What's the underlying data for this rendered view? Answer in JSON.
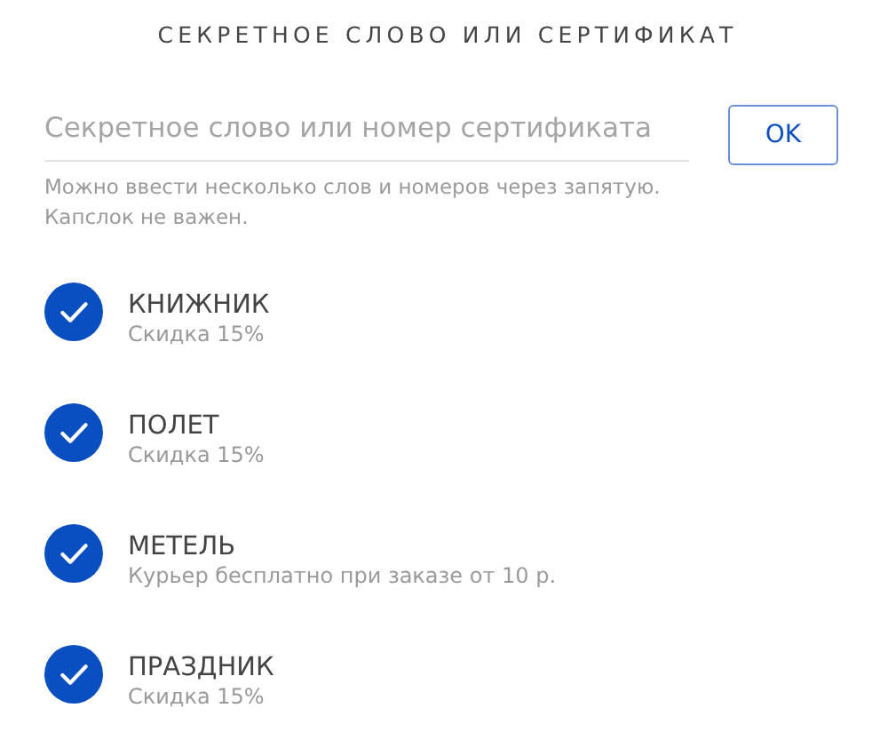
{
  "title": "СЕКРЕТНОЕ СЛОВО ИЛИ СЕРТИФИКАТ",
  "code_field": {
    "placeholder": "Секретное слово или номер сертификата"
  },
  "submit_button": "OK",
  "hint": [
    "Можно ввести несколько слов и номеров через запятую.",
    "Капслок не важен."
  ],
  "codes": [
    {
      "name": "КНИЖНИК",
      "description": "Скидка 15%",
      "checked": true
    },
    {
      "name": "ПОЛЕТ",
      "description": "Скидка 15%",
      "checked": true
    },
    {
      "name": "МЕТЕЛЬ",
      "description": "Курьер бесплатно при заказе от 10 р.",
      "checked": true
    },
    {
      "name": "ПРАЗДНИК",
      "description": "Скидка 15%",
      "checked": true
    }
  ]
}
